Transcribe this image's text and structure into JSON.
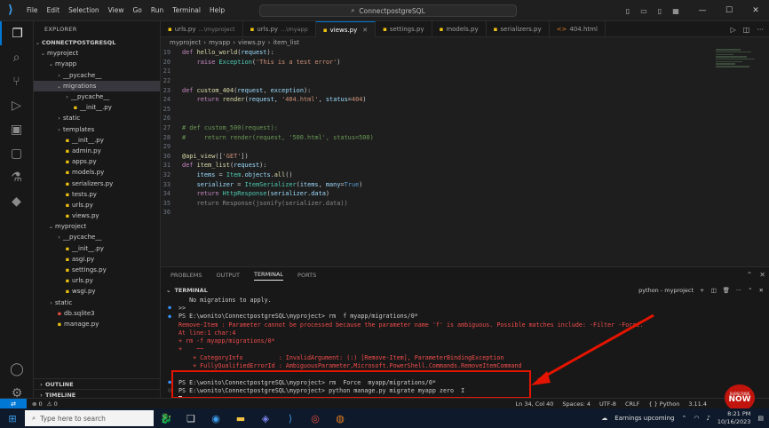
{
  "app": {
    "title": "ConnectpostgreSQL",
    "menu": [
      "File",
      "Edit",
      "Selection",
      "View",
      "Go",
      "Run",
      "Terminal",
      "Help"
    ]
  },
  "explorer": {
    "header": "EXPLORER",
    "project": "CONNECTPOSTGRESQL",
    "items": [
      {
        "label": "myproject",
        "depth": 0,
        "kind": "folder-open"
      },
      {
        "label": "myapp",
        "depth": 1,
        "kind": "folder-open"
      },
      {
        "label": "__pycache__",
        "depth": 2,
        "kind": "folder"
      },
      {
        "label": "migrations",
        "depth": 2,
        "kind": "folder-open",
        "selected": true
      },
      {
        "label": "__pycache__",
        "depth": 3,
        "kind": "folder"
      },
      {
        "label": "__init__.py",
        "depth": 3,
        "kind": "py"
      },
      {
        "label": "static",
        "depth": 2,
        "kind": "folder"
      },
      {
        "label": "templates",
        "depth": 2,
        "kind": "folder"
      },
      {
        "label": "__init__.py",
        "depth": 2,
        "kind": "py"
      },
      {
        "label": "admin.py",
        "depth": 2,
        "kind": "py"
      },
      {
        "label": "apps.py",
        "depth": 2,
        "kind": "py"
      },
      {
        "label": "models.py",
        "depth": 2,
        "kind": "py"
      },
      {
        "label": "serializers.py",
        "depth": 2,
        "kind": "py"
      },
      {
        "label": "tests.py",
        "depth": 2,
        "kind": "py"
      },
      {
        "label": "urls.py",
        "depth": 2,
        "kind": "py"
      },
      {
        "label": "views.py",
        "depth": 2,
        "kind": "py"
      },
      {
        "label": "myproject",
        "depth": 1,
        "kind": "folder-open"
      },
      {
        "label": "__pycache__",
        "depth": 2,
        "kind": "folder"
      },
      {
        "label": "__init__.py",
        "depth": 2,
        "kind": "py"
      },
      {
        "label": "asgi.py",
        "depth": 2,
        "kind": "py"
      },
      {
        "label": "settings.py",
        "depth": 2,
        "kind": "py"
      },
      {
        "label": "urls.py",
        "depth": 2,
        "kind": "py"
      },
      {
        "label": "wsgi.py",
        "depth": 2,
        "kind": "py"
      },
      {
        "label": "static",
        "depth": 1,
        "kind": "folder"
      },
      {
        "label": "db.sqlite3",
        "depth": 1,
        "kind": "db"
      },
      {
        "label": "manage.py",
        "depth": 1,
        "kind": "py"
      }
    ],
    "outline": "OUTLINE",
    "timeline": "TIMELINE"
  },
  "tabs": [
    {
      "label": "urls.py",
      "path": "...\\myproject",
      "active": false
    },
    {
      "label": "urls.py",
      "path": "...\\myapp",
      "active": false
    },
    {
      "label": "views.py",
      "path": "",
      "active": true
    },
    {
      "label": "settings.py",
      "path": "",
      "active": false
    },
    {
      "label": "models.py",
      "path": "",
      "active": false
    },
    {
      "label": "serializers.py",
      "path": "",
      "active": false
    },
    {
      "label": "404.html",
      "path": "",
      "active": false
    }
  ],
  "breadcrumb": [
    "myproject",
    "myapp",
    "views.py",
    "item_list"
  ],
  "code": [
    {
      "n": "19",
      "tokens": [
        [
          "kw",
          "def "
        ],
        [
          "fn",
          "hello_world"
        ],
        [
          "",
          "("
        ],
        [
          "va",
          "request"
        ],
        [
          "",
          "):"
        ]
      ]
    },
    {
      "n": "20",
      "tokens": [
        [
          "",
          "    "
        ],
        [
          "kw",
          "raise "
        ],
        [
          "ty",
          "Exception"
        ],
        [
          "",
          "("
        ],
        [
          "str",
          "'This is a test error'"
        ],
        [
          "",
          ")"
        ]
      ]
    },
    {
      "n": "21",
      "tokens": []
    },
    {
      "n": "22",
      "tokens": []
    },
    {
      "n": "23",
      "tokens": [
        [
          "kw",
          "def "
        ],
        [
          "fn",
          "custom_404"
        ],
        [
          "",
          "("
        ],
        [
          "va",
          "request"
        ],
        [
          "",
          ", "
        ],
        [
          "va",
          "exception"
        ],
        [
          "",
          "):"
        ]
      ]
    },
    {
      "n": "24",
      "tokens": [
        [
          "",
          "    "
        ],
        [
          "kw",
          "return "
        ],
        [
          "fn",
          "render"
        ],
        [
          "",
          "("
        ],
        [
          "va",
          "request"
        ],
        [
          "",
          ", "
        ],
        [
          "str",
          "'404.html'"
        ],
        [
          "",
          ", "
        ],
        [
          "va",
          "status"
        ],
        [
          "",
          "="
        ],
        [
          "str",
          "404"
        ],
        [
          "",
          ")"
        ]
      ]
    },
    {
      "n": "25",
      "tokens": []
    },
    {
      "n": "26",
      "tokens": []
    },
    {
      "n": "27",
      "tokens": [
        [
          "cm",
          "# def custom_500(request):"
        ]
      ]
    },
    {
      "n": "28",
      "tokens": [
        [
          "cm",
          "#     return render(request, '500.html', status=500)"
        ]
      ]
    },
    {
      "n": "29",
      "tokens": []
    },
    {
      "n": "30",
      "tokens": [
        [
          "dc",
          "@api_view"
        ],
        [
          "",
          "(["
        ],
        [
          "str",
          "'GET'"
        ],
        [
          "",
          "])"
        ]
      ]
    },
    {
      "n": "31",
      "tokens": [
        [
          "kw",
          "def "
        ],
        [
          "fn",
          "item_list"
        ],
        [
          "",
          "("
        ],
        [
          "va",
          "request"
        ],
        [
          "",
          "):"
        ]
      ]
    },
    {
      "n": "32",
      "tokens": [
        [
          "",
          "    "
        ],
        [
          "va",
          "items"
        ],
        [
          "",
          " = "
        ],
        [
          "ty",
          "Item"
        ],
        [
          "",
          "."
        ],
        [
          "va",
          "objects"
        ],
        [
          "",
          "."
        ],
        [
          "fn",
          "all"
        ],
        [
          "",
          "()"
        ]
      ]
    },
    {
      "n": "33",
      "tokens": [
        [
          "",
          "    "
        ],
        [
          "va",
          "serializer"
        ],
        [
          "",
          " = "
        ],
        [
          "ty",
          "ItemSerializer"
        ],
        [
          "",
          "("
        ],
        [
          "va",
          "items"
        ],
        [
          "",
          ", "
        ],
        [
          "va",
          "many"
        ],
        [
          "",
          "="
        ],
        [
          "bl",
          "True"
        ],
        [
          "",
          ")"
        ]
      ]
    },
    {
      "n": "34",
      "tokens": [
        [
          "",
          "    "
        ],
        [
          "kw",
          "return "
        ],
        [
          "ty",
          "HttpResponse"
        ],
        [
          "",
          "("
        ],
        [
          "va",
          "serializer"
        ],
        [
          "",
          "."
        ],
        [
          "va",
          "data"
        ],
        [
          "",
          ")"
        ]
      ]
    },
    {
      "n": "35",
      "tokens": [
        [
          "",
          "    "
        ],
        [
          "gr",
          "return Response(jsonify(serializer.data))"
        ]
      ]
    },
    {
      "n": "36",
      "tokens": []
    }
  ],
  "panel": {
    "tabs": [
      "PROBLEMS",
      "OUTPUT",
      "TERMINAL",
      "PORTS"
    ],
    "active_tab": "TERMINAL",
    "terminal_header": "TERMINAL",
    "shell": "python - myproject"
  },
  "terminal": [
    {
      "g": "",
      "cls": "",
      "t": "   No migrations to apply."
    },
    {
      "g": "●",
      "cls": "",
      "t": ">>"
    },
    {
      "g": "●",
      "cls": "",
      "t": "PS E:\\wonito\\ConnectpostgreSQL\\myproject> rm  f myapp/migrations/0*"
    },
    {
      "g": "",
      "cls": "err",
      "t": "Remove-Item : Parameter cannot be processed because the parameter name 'f' is ambiguous. Possible matches include: -Filter -Force."
    },
    {
      "g": "",
      "cls": "err",
      "t": "At line:1 char:4"
    },
    {
      "g": "",
      "cls": "err",
      "t": "+ rm -f myapp/migrations/0*"
    },
    {
      "g": "",
      "cls": "err",
      "t": "+    ~~"
    },
    {
      "g": "",
      "cls": "err",
      "t": "    + CategoryInfo          : InvalidArgument: (:) [Remove-Item], ParameterBindingException"
    },
    {
      "g": "",
      "cls": "err",
      "t": "    + FullyQualifiedErrorId : AmbiguousParameter,Microsoft.PowerShell.Commands.RemoveItemCommand"
    },
    {
      "g": "",
      "cls": "",
      "t": " "
    },
    {
      "g": "●",
      "cls": "",
      "t": "PS E:\\wonito\\ConnectpostgreSQL\\myproject> rm  Force  myapp/migrations/0*"
    },
    {
      "g": "○",
      "cls": "",
      "t": "PS E:\\wonito\\ConnectpostgreSQL\\myproject> python manage.py migrate myapp zero"
    }
  ],
  "status": {
    "errors": "0",
    "warnings": "0",
    "position": "Ln 34, Col 40",
    "spaces": "Spaces: 4",
    "encoding": "UTF-8",
    "eol": "CRLF",
    "language": "Python",
    "version": "3.11.4"
  },
  "taskbar": {
    "search_placeholder": "Type here to search",
    "weather": "Earnings upcoming",
    "time": "8:21 PM",
    "date": "10/16/2023"
  },
  "badge": {
    "top": "SUBSCRIBE",
    "main": "NOW"
  },
  "colors": {
    "accent": "#0078d4",
    "highlight_box": "#e51400",
    "error_text": "#f14c4c"
  }
}
